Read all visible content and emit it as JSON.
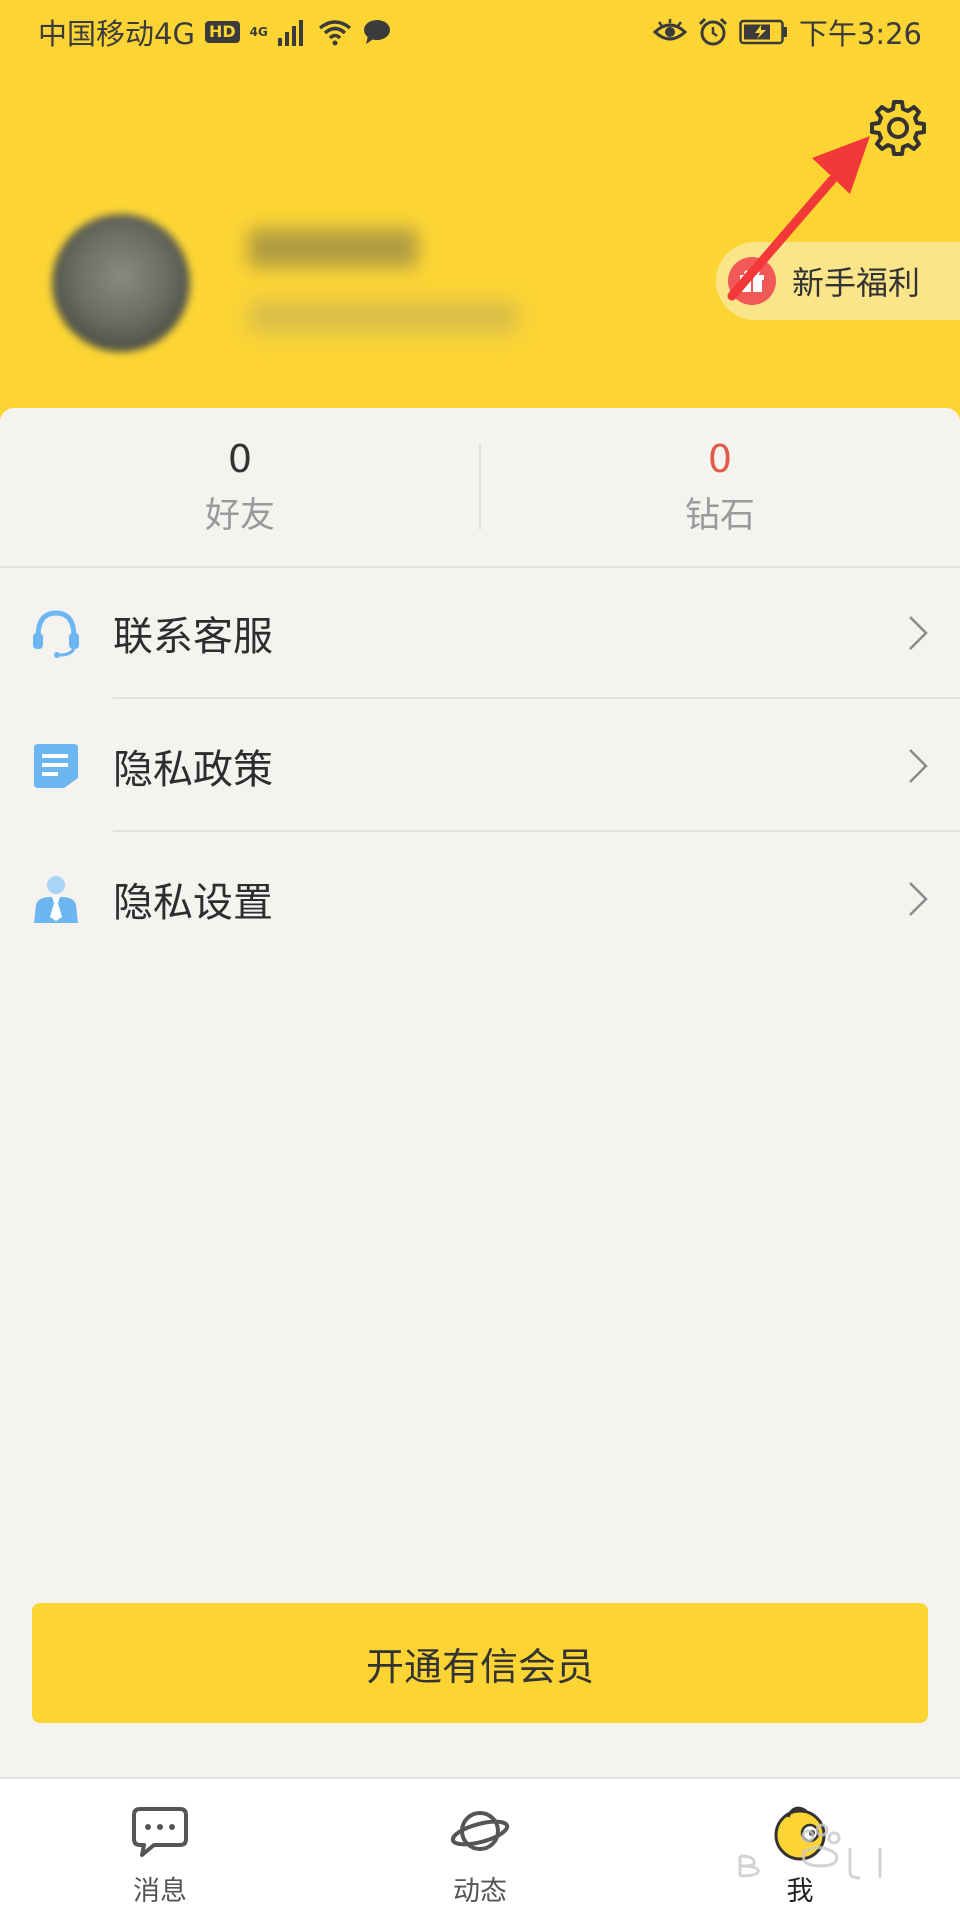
{
  "status_bar": {
    "carrier": "中国移动4G",
    "hd": "HD",
    "signal_label": "4G",
    "time": "下午3:26"
  },
  "header": {
    "welfare_label": "新手福利"
  },
  "stats": [
    {
      "value": "0",
      "label": "好友"
    },
    {
      "value": "0",
      "label": "钻石",
      "value_color": "#e05a47"
    }
  ],
  "menu": {
    "items": [
      {
        "label": "联系客服",
        "icon": "headset-icon"
      },
      {
        "label": "隐私政策",
        "icon": "document-icon"
      },
      {
        "label": "隐私设置",
        "icon": "person-icon"
      }
    ]
  },
  "vip_button": {
    "label": "开通有信会员"
  },
  "tabs": [
    {
      "label": "消息",
      "icon": "chat-bubble-icon"
    },
    {
      "label": "动态",
      "icon": "planet-icon"
    },
    {
      "label": "我",
      "icon": "profile-mascot-icon",
      "active": true
    }
  ],
  "colors": {
    "accent": "#fcd535",
    "diamond_value": "#e05a47",
    "icon_blue": "#6cb6f2"
  }
}
